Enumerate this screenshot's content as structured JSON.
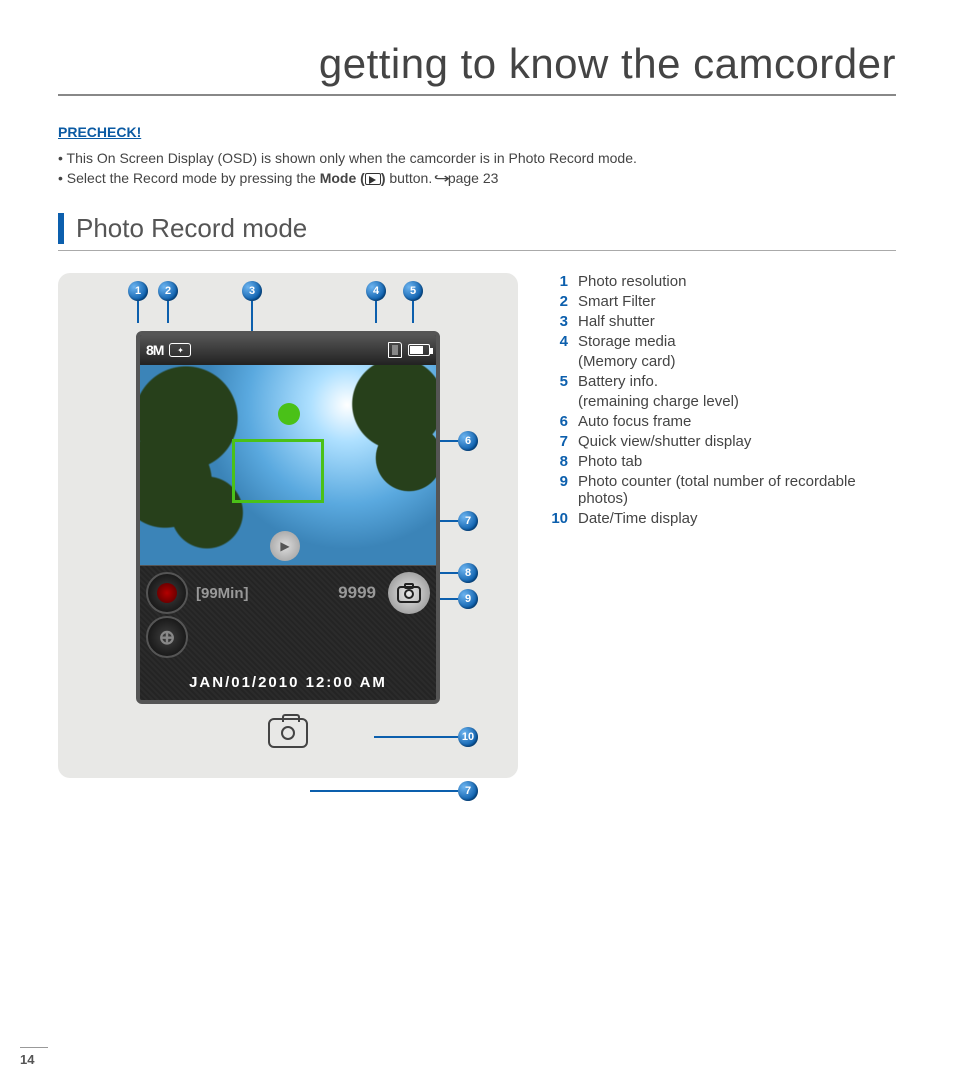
{
  "title": "getting to know the camcorder",
  "precheck": {
    "heading": "PRECHECK!",
    "items": [
      "This On Screen Display (OSD) is shown only when the camcorder is in Photo Record mode.",
      "Select the Record mode by pressing the Mode (▶) button. ↪page 23"
    ],
    "item2_prefix": "Select the Record mode by pressing the ",
    "item2_strong": "Mode (",
    "item2_strong_tail": ")",
    "item2_suffix": " button. ",
    "item2_ref": "page 23"
  },
  "section_heading": "Photo Record mode",
  "osd": {
    "resolution": "8M",
    "remaining_time": "[99Min]",
    "photo_counter": "9999",
    "datetime": "JAN/01/2010 12:00 AM"
  },
  "legend": [
    {
      "n": "1",
      "t": "Photo resolution"
    },
    {
      "n": "2",
      "t": "Smart Filter"
    },
    {
      "n": "3",
      "t": "Half shutter"
    },
    {
      "n": "4",
      "t": "Storage media",
      "sub": "(Memory card)"
    },
    {
      "n": "5",
      "t": "Battery info.",
      "sub": "(remaining charge level)"
    },
    {
      "n": "6",
      "t": "Auto focus frame"
    },
    {
      "n": "7",
      "t": "Quick view/shutter display"
    },
    {
      "n": "8",
      "t": "Photo tab"
    },
    {
      "n": "9",
      "t": "Photo counter (total number of recordable photos)"
    },
    {
      "n": "10",
      "t": "Date/Time display"
    }
  ],
  "page_number": "14"
}
